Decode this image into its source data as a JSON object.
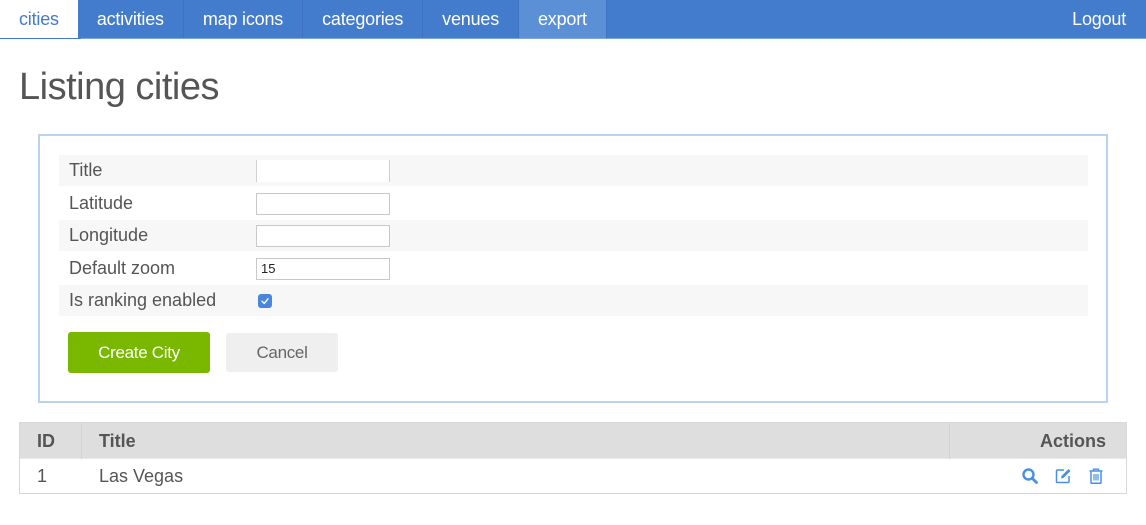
{
  "nav": {
    "items": [
      {
        "label": "cities",
        "state": "active"
      },
      {
        "label": "activities",
        "state": "normal"
      },
      {
        "label": "map icons",
        "state": "normal"
      },
      {
        "label": "categories",
        "state": "normal"
      },
      {
        "label": "venues",
        "state": "normal"
      },
      {
        "label": "export",
        "state": "hover"
      }
    ],
    "logout_label": "Logout"
  },
  "page": {
    "title": "Listing cities"
  },
  "form": {
    "fields": [
      {
        "label": "Title",
        "value": "",
        "type": "text"
      },
      {
        "label": "Latitude",
        "value": "",
        "type": "text"
      },
      {
        "label": "Longitude",
        "value": "",
        "type": "text"
      },
      {
        "label": "Default zoom",
        "value": "15",
        "type": "text"
      },
      {
        "label": "Is ranking enabled",
        "checked": true,
        "type": "checkbox"
      }
    ],
    "create_label": "Create City",
    "cancel_label": "Cancel"
  },
  "table": {
    "headers": {
      "id": "ID",
      "title": "Title",
      "actions": "Actions"
    },
    "rows": [
      {
        "id": "1",
        "title": "Las Vegas",
        "actions": [
          "view-icon",
          "edit-icon",
          "delete-icon"
        ]
      }
    ]
  },
  "colors": {
    "nav_bg": "#437bcd",
    "create_button": "#7ab800",
    "action_icon": "#4a90e2",
    "checkbox": "#4a86dd"
  }
}
